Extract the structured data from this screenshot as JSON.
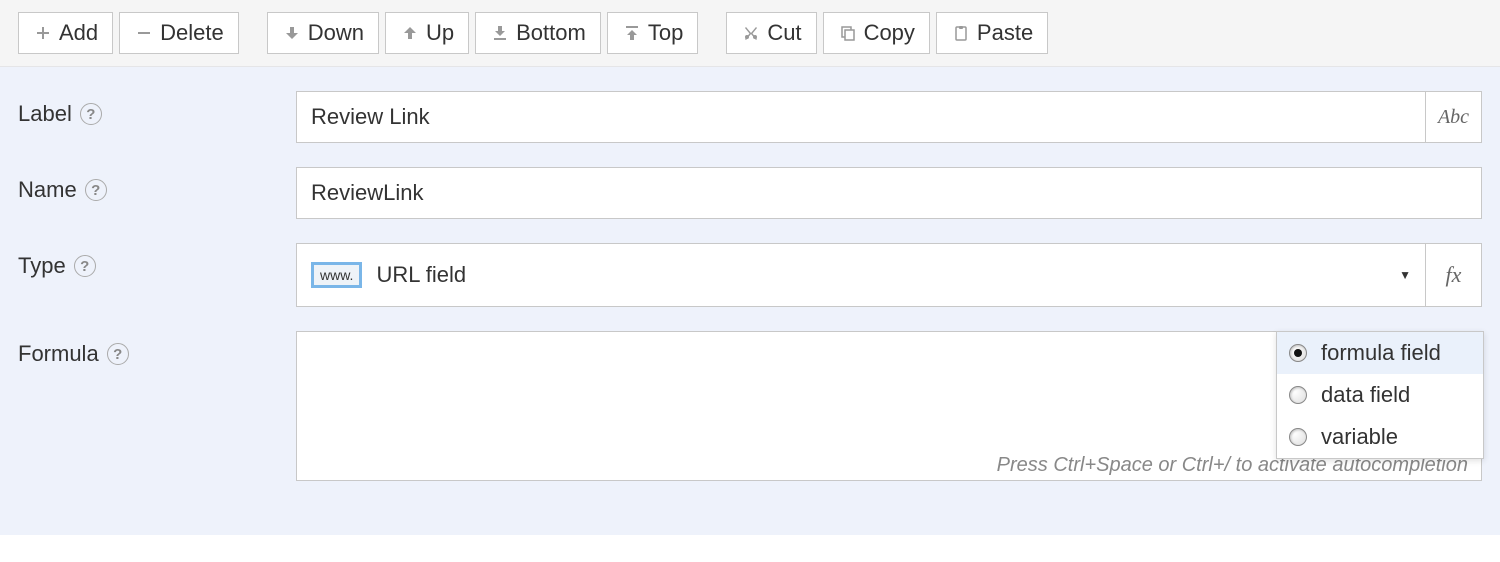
{
  "toolbar": {
    "group1": {
      "add": "Add",
      "delete": "Delete"
    },
    "group2": {
      "down": "Down",
      "up": "Up",
      "bottom": "Bottom",
      "top": "Top"
    },
    "group3": {
      "cut": "Cut",
      "copy": "Copy",
      "paste": "Paste"
    }
  },
  "form": {
    "label": {
      "text": "Label",
      "value": "Review Link",
      "addon": "Abc"
    },
    "name": {
      "text": "Name",
      "value": "ReviewLink"
    },
    "type": {
      "text": "Type",
      "icon_text": "www.",
      "value": "URL field",
      "fx": "fx"
    },
    "formula": {
      "text": "Formula",
      "value": "",
      "hint": "Press Ctrl+Space or Ctrl+/ to activate autocompletion"
    }
  },
  "dropdown": {
    "items": [
      {
        "label": "formula field",
        "selected": true
      },
      {
        "label": "data field",
        "selected": false
      },
      {
        "label": "variable",
        "selected": false
      }
    ]
  },
  "help_glyph": "?"
}
